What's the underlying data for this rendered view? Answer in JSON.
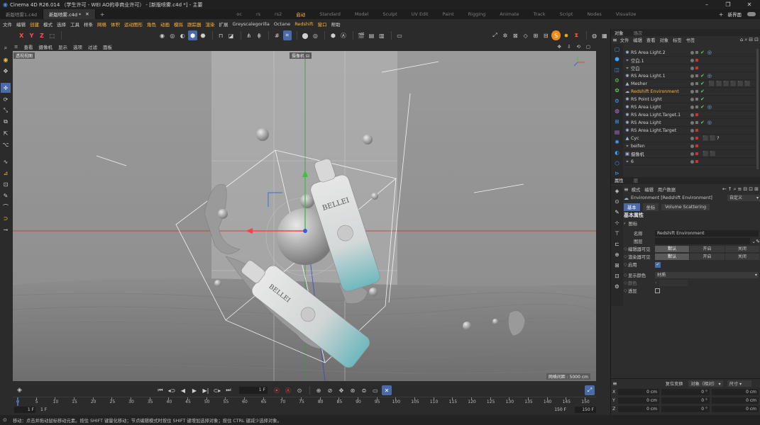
{
  "titlebar": {
    "title": "Cinema 4D R26.014 （学生许可 - WEI AO的非商业许可） - [新版喷雾.c4d *] - 主要",
    "controls": [
      "–",
      "❐",
      "✕"
    ]
  },
  "tabs": {
    "docs": [
      {
        "label": "新版喷雾1.c4d"
      },
      {
        "label": "新版喷雾.c4d *"
      }
    ],
    "add": "+",
    "layouts": [
      "oc",
      "rs",
      "rs2",
      "启动",
      "Standard",
      "Model",
      "Sculpt",
      "UV Edit",
      "Paint",
      "Rigging",
      "Animate",
      "Track",
      "Script",
      "Nodes",
      "Visualize"
    ],
    "active_layout": "启动",
    "new_ui": "新界面"
  },
  "menubar": [
    "文件",
    "编辑",
    "创建",
    "模式",
    "选择",
    "工具",
    "样条",
    "网格",
    "体积",
    "运动图形",
    "角色",
    "动画",
    "模拟",
    "跟踪器",
    "渲染",
    "扩展",
    "Greyscalegorilla",
    "Octane",
    "Redshift",
    "窗口",
    "帮助"
  ],
  "menubar_highlight": [
    "创建",
    "网格",
    "体积",
    "运动图形",
    "角色",
    "动画",
    "模拟",
    "跟踪器",
    "渲染",
    "Redshift",
    "窗口"
  ],
  "toolbar": {
    "axes": [
      "X",
      "Y",
      "Z"
    ]
  },
  "viewport": {
    "menu": [
      "查看",
      "摄像机",
      "显示",
      "选项",
      "过滤",
      "面板"
    ],
    "view_label": "透视视图",
    "camera_label": "摄像机",
    "grid_info": "网格间距 : 5000 cm",
    "product_text": "BELLEI"
  },
  "timeline": {
    "ticks": [
      "0",
      "5",
      "10",
      "15",
      "20",
      "25",
      "30",
      "35",
      "40",
      "45",
      "50",
      "55",
      "60",
      "65",
      "70",
      "75",
      "80",
      "85",
      "90",
      "95",
      "100",
      "105",
      "110",
      "115",
      "120",
      "125",
      "130",
      "135",
      "140",
      "145",
      "150"
    ],
    "current_frame": "1 F",
    "start": "1 F",
    "start2": "1 F",
    "end": "150 F",
    "end2": "150 F",
    "marker": "0"
  },
  "statusbar": {
    "text": "移动：点击并拖动鼠标移动元素。按住 SHIFT 键量化移动；节点编辑模式时按住 SHIFT 键增加选择对象；按住 CTRL 键减少选择对象。"
  },
  "objects_panel": {
    "tabs": [
      "对象",
      "场次"
    ],
    "menu": [
      "文件",
      "编辑",
      "查看",
      "对象",
      "标签",
      "书签"
    ],
    "rows": [
      {
        "name": "RS Area Light.2",
        "icon": "✺",
        "check": true,
        "circle": true
      },
      {
        "name": "空白.1",
        "icon": "⌖",
        "check": false,
        "circle": false
      },
      {
        "name": "空白",
        "icon": "⌖",
        "check": false,
        "circle": false
      },
      {
        "name": "RS Area Light.1",
        "icon": "✺",
        "check": true,
        "circle": true
      },
      {
        "name": "Mesher",
        "icon": "▲",
        "check": true,
        "circle": false,
        "tags": "⬛⬛⬛⬛⬛⬛"
      },
      {
        "name": "Redshift Environment",
        "icon": "☁",
        "check": true,
        "circle": false,
        "selected": true
      },
      {
        "name": "RS Point Light",
        "icon": "✺",
        "check": true,
        "circle": false
      },
      {
        "name": "RS Area Light",
        "icon": "✺",
        "check": true,
        "circle": true
      },
      {
        "name": "RS Area Light.Target.1",
        "icon": "✺",
        "check": false,
        "circle": false
      },
      {
        "name": "RS Area Light",
        "icon": "✺",
        "check": true,
        "circle": true
      },
      {
        "name": "RS Area Light.Target",
        "icon": "✺",
        "check": false,
        "circle": false
      },
      {
        "name": "Cyc",
        "icon": "▲",
        "check": false,
        "circle": false,
        "tags": "⬛⬛?"
      },
      {
        "name": "beifen",
        "icon": "⌖",
        "check": false,
        "circle": false
      },
      {
        "name": "摄像机",
        "icon": "▣",
        "check": false,
        "circle": false,
        "tags": "⬛⬛"
      },
      {
        "name": "6",
        "icon": "⌖",
        "check": false,
        "circle": false
      }
    ]
  },
  "attributes_panel": {
    "tabs": [
      "属性",
      "层"
    ],
    "menu": [
      "模式",
      "编辑",
      "用户数据"
    ],
    "object_title": "Environment [Redshift Environment]",
    "preset": "自定义",
    "subtabs": [
      "基本",
      "坐标",
      "Volume Scattering"
    ],
    "section": "基本属性",
    "icon_label": "图标",
    "fields": {
      "name_label": "名称",
      "name_value": "Redshift Environment",
      "layer_label": "图层",
      "editor_vis_label": "编辑器可见",
      "render_vis_label": "渲染器可见",
      "vis_options": [
        "默认",
        "开启",
        "关闭"
      ],
      "enable_label": "启用",
      "display_color_label": "显示颜色",
      "display_color_value": "材质",
      "color_label": "颜色",
      "transparent_label": "透显"
    }
  },
  "coords_panel": {
    "buttons": [
      "复位变换",
      "对象（相对）",
      "尺寸"
    ],
    "rows": [
      {
        "axis": "X",
        "pos": "0 cm",
        "rot": "0 °",
        "size": "0 cm"
      },
      {
        "axis": "Y",
        "pos": "0 cm",
        "rot": "0 °",
        "size": "0 cm"
      },
      {
        "axis": "Z",
        "pos": "0 cm",
        "rot": "0 °",
        "size": "0 cm"
      }
    ]
  },
  "colors": {
    "accent": "#ffb43a",
    "active_tool": "#4a6aa8",
    "viewport_bg": "#9c9c9c",
    "bottle_teal": "#6fb8bd"
  }
}
